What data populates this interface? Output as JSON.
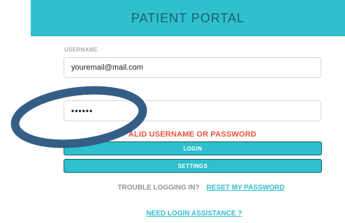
{
  "header": {
    "title": "PATIENT PORTAL"
  },
  "login_form": {
    "username_label": "USERNAME",
    "username_value": "youremail@mail.com",
    "password_value": "••••••",
    "error_message": "ALID USERNAME OR PASSWORD",
    "login_button": "LOGIN",
    "settings_button": "SETTINGS"
  },
  "help": {
    "trouble_text": "TROUBLE LOGGING IN?",
    "reset_link": "RESET MY PASSWORD",
    "assistance_link": "NEED LOGIN ASSISTANCE ?"
  },
  "colors": {
    "accent": "#2fbfcd",
    "header_text": "#1c5f73",
    "error": "#e8533e",
    "annotation_ring": "#345e86"
  }
}
